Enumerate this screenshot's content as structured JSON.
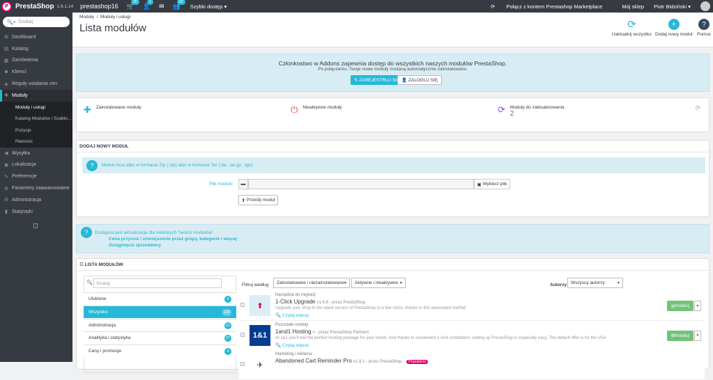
{
  "header": {
    "logo_text": "PrestaShop",
    "version": "1.6.1.14",
    "shop": "prestashop16",
    "badge_orders": "20",
    "badge_customers": "1",
    "badge_messages": "",
    "badge_new": "52",
    "quick": "Szybki dostęp ▾",
    "connect": "Połącz z kontem Prestashop Marketplace",
    "my_shop": "Mój sklep",
    "user": "Piotr Bidziński ▾"
  },
  "sidebar": {
    "search_placeholder": "Szukaj",
    "items": [
      {
        "label": "Dashboard",
        "icon": "⊞"
      },
      {
        "label": "Katalog",
        "icon": "▤"
      },
      {
        "label": "Zamówienia",
        "icon": "▦"
      },
      {
        "label": "Klienci",
        "icon": "☻"
      },
      {
        "label": "Reguły ustalania cen",
        "icon": "◈"
      },
      {
        "label": "Moduły",
        "icon": "✚"
      }
    ],
    "subitems": [
      "Moduły i usługi",
      "Katalog Modułów i Szablo...",
      "Pozycje",
      "Płatność"
    ],
    "items2": [
      {
        "label": "Wysyłka",
        "icon": "◀"
      },
      {
        "label": "Lokalizacja",
        "icon": "◉"
      },
      {
        "label": "Preferencje",
        "icon": "✎"
      },
      {
        "label": "Parametry zaawansowane",
        "icon": "⚙"
      },
      {
        "label": "Administracja",
        "icon": "⚙"
      },
      {
        "label": "Statystyki",
        "icon": "▮"
      }
    ]
  },
  "page": {
    "breadcrumb1": "Moduły",
    "breadcrumb_sep": "/",
    "breadcrumb2": "Moduły i usługi",
    "title": "Lista modułów",
    "tb_update": "Uaktualnij wszystko",
    "tb_add": "Dodaj nowy moduł",
    "tb_help": "Pomoc"
  },
  "addons": {
    "title": "Członkostwo w Addons zapewnia dostęp do wszystkich naszych modułów PrestaShop.",
    "subtitle": "Po połączeniu, Twoje nowe moduły zostaną automatycznie zainstalowane.",
    "register": "ZAREJESTRUJ SIĘ",
    "login": "ZALOGUJ SIĘ"
  },
  "stats": {
    "installed": "Zainstalowane moduły",
    "inactive": "Nieaktywne moduły",
    "to_update": "Moduły do zaktualizowania",
    "to_update_val": "2"
  },
  "add_module": {
    "title": "DODAJ NOWY MODUŁ",
    "info": "Moduł musi albo w formacie Zip (.zip) albo w formacie Tar (.tar, .tar.gz, .tgz).",
    "file_label": "Plik modułu",
    "choose": "Wybierz plik",
    "upload": "Prześlij moduł"
  },
  "update_info": {
    "text": "Dostępna jest aktualizacja dla niektórych Twoich modułów!",
    "link1": "Cena przyrost / zmniejszenie przez grupy, kategorie i więcej",
    "link2": "Osiągnięcia sprzedawcy"
  },
  "module_list": {
    "title": "LISTA MODUŁÓW",
    "search_placeholder": "Szukaj",
    "categories": [
      {
        "label": "Ulubione",
        "count": "0"
      },
      {
        "label": "Wszystko",
        "count": "222"
      },
      {
        "label": "Administracja",
        "count": "21"
      },
      {
        "label": "Analityka i statystyka",
        "count": "27"
      },
      {
        "label": "Ceny i promocje",
        "count": "4"
      }
    ],
    "filter_label": "Filtruj według",
    "filter1": "Zainstalowane i niezainstalowane",
    "filter2": "Aktywne i nieaktywne",
    "authors_label": "Autorzy",
    "authors": "Wszyscy autorzy",
    "modules": [
      {
        "category": "Narzędzia do migracji",
        "name": "1-Click Upgrade",
        "meta": "v1.6.8 - przez PrestaShop",
        "desc": "Upgrade your shop to the latest version of PrestaShop in a few clicks, thanks to this automated method",
        "more": "Czytaj więcej",
        "install": "Instaluj",
        "logo": "⬆"
      },
      {
        "category": "Pozostałe moduły",
        "name": "1and1 Hosting",
        "meta": "v - przez PrestaShop Partners",
        "desc": "At 1&1 you'll find the perfect hosting package for your needs. And thanks to convenient 1-click installation, setting up PrestaShop is especially easy. The default offer is for the USA",
        "more": "Czytaj więcej",
        "install": "Instaluj",
        "logo": "1&1"
      },
      {
        "category": "Marketing i reklama",
        "name": "Abandoned Cart Reminder Pro",
        "meta": "v1.8.1 - przez PrestaShop -",
        "badge": "Popularne",
        "logo": "✈"
      }
    ]
  },
  "colors": {
    "accent": "#25b9d7",
    "header": "#363a41",
    "green": "#72c279",
    "pink": "#df0067"
  }
}
